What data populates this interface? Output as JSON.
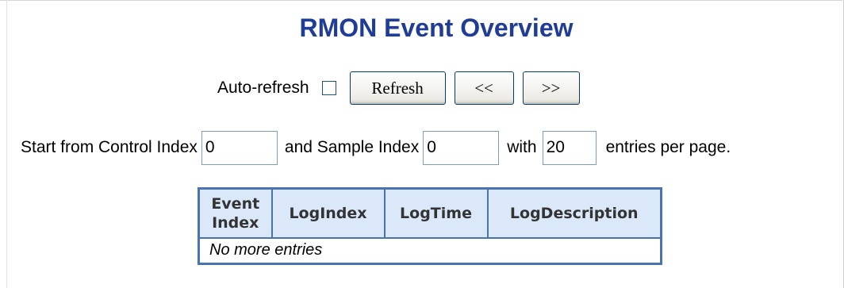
{
  "page": {
    "title": "RMON Event Overview",
    "title_color": "#1f3c96"
  },
  "toolbar": {
    "auto_refresh_label": "Auto-refresh",
    "auto_refresh_checked": false,
    "refresh_label": "Refresh",
    "first_page_label": "|<<",
    "prev_page_label": "<<",
    "next_page_label": ">>"
  },
  "paging": {
    "start_label": "Start from Control Index",
    "control_index": "0",
    "sample_label": "and Sample Index",
    "sample_index": "0",
    "with_label": "with",
    "entries": "20",
    "entries_suffix": "entries per page."
  },
  "table": {
    "columns": [
      "Event Index",
      "LogIndex",
      "LogTime",
      "LogDescription"
    ],
    "empty_message": "No more entries",
    "border_color": "#4a73b4",
    "header_bg": "#dae8fa"
  }
}
